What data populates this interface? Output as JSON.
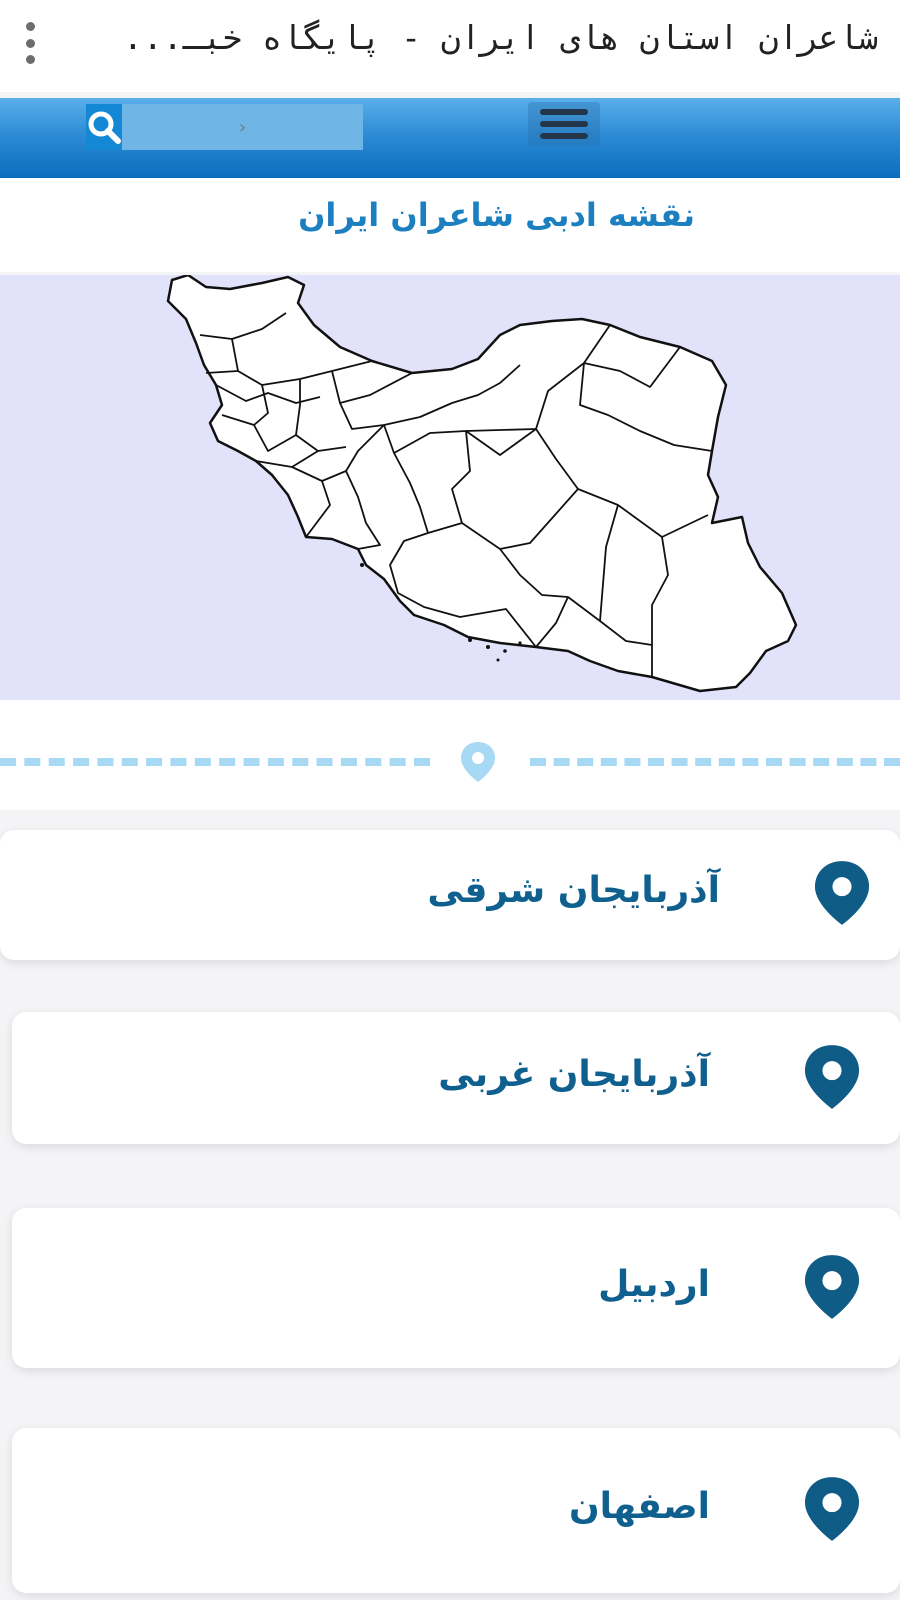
{
  "browser": {
    "tab_title": "شاعران استان های ایران - پایگاه خبـ..."
  },
  "header": {
    "search_placeholder": "›",
    "menu_icon": "hamburger-icon",
    "search_icon": "search-icon"
  },
  "main": {
    "map_heading": "نقشه ادبی شاعران ایران"
  },
  "provinces": [
    {
      "name": "آذربایجان شرقی"
    },
    {
      "name": "آذربایجان غربی"
    },
    {
      "name": "اردبیل"
    },
    {
      "name": "اصفهان"
    }
  ],
  "colors": {
    "header_blue": "#1488d4",
    "heading_text": "#1b7fc0",
    "province_text": "#10608f",
    "pin": "#0f5c86",
    "divider": "#a7d9f5",
    "map_background": "#e2e2fa"
  }
}
